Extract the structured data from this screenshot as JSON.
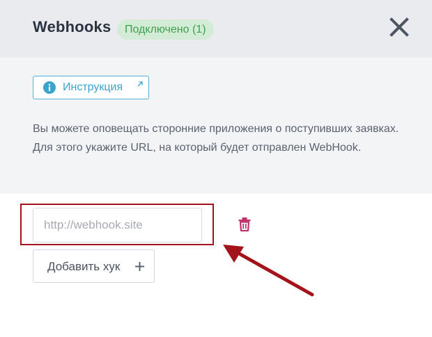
{
  "header": {
    "title": "Webhooks",
    "status_badge": "Подключено (1)",
    "close_icon": "close-icon"
  },
  "info": {
    "instruction_label": "Инструкция",
    "instruction_icon": "info-icon",
    "external_icon": "external-link-icon",
    "description": "Вы можете оповещать сторонние приложения о поступивших заявках. Для этого укажите URL, на который будет отправлен WebHook."
  },
  "webhooks": {
    "url_value": "",
    "url_placeholder": "http://webhook.site",
    "delete_icon": "trash-icon",
    "add_label": "Добавить хук",
    "add_icon": "plus-icon"
  },
  "colors": {
    "header_bg": "#e9ebee",
    "info_bg": "#f3f4f6",
    "badge_bg": "#d3ecd6",
    "badge_text": "#3f9e52",
    "accent": "#3aa4cc",
    "delete": "#c0326a",
    "annotation": "#a31319"
  }
}
